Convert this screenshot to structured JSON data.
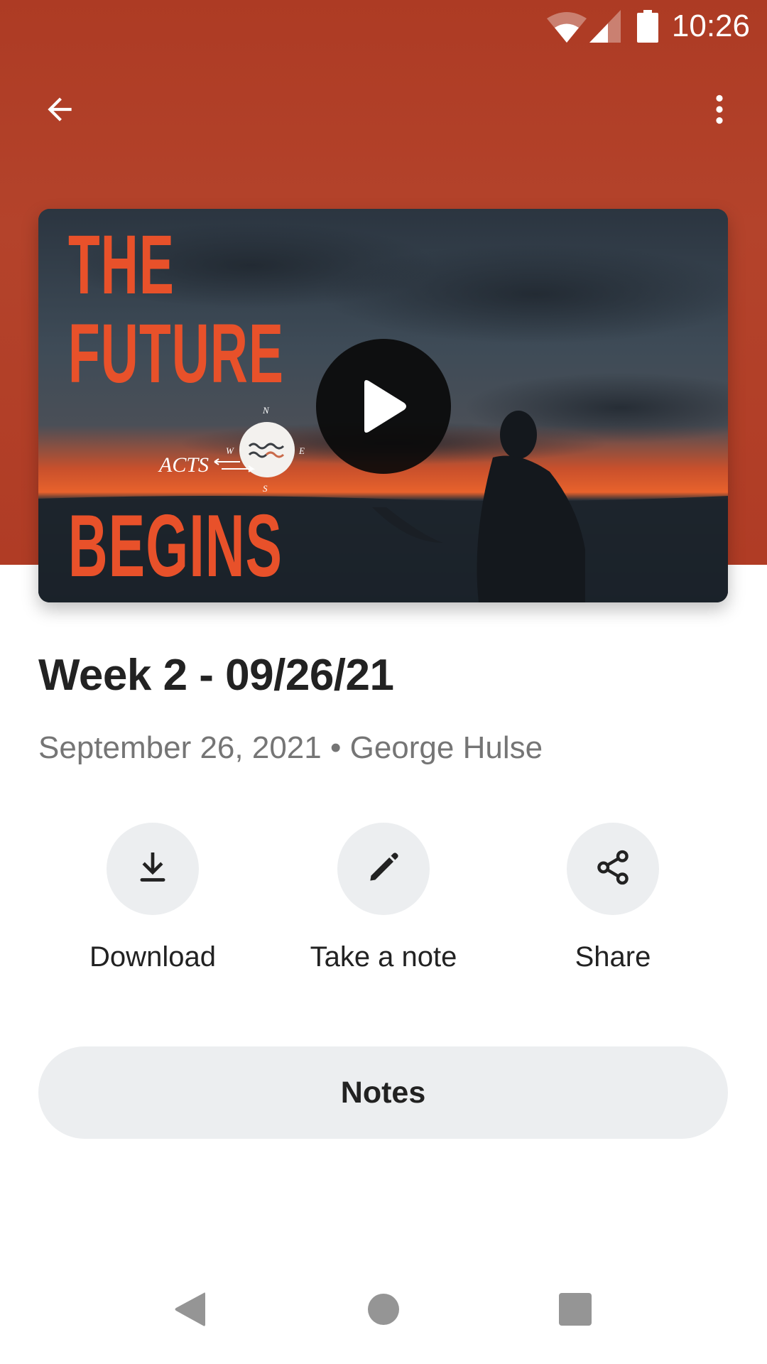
{
  "colors": {
    "header": "#b03c25",
    "thumbnail_title": "#e8512a",
    "title_text": "#222222",
    "subtitle_text": "#757575",
    "button_bg": "#eceef0",
    "nav_icon": "#959595"
  },
  "status_bar": {
    "time": "10:26",
    "icons": [
      "wifi-icon",
      "cell-signal-icon",
      "battery-icon"
    ]
  },
  "toolbar": {
    "back_icon": "arrow-back-icon",
    "menu_icon": "more-vert-icon"
  },
  "media": {
    "thumbnail": {
      "title_line1": "THE",
      "title_line2": "FUTURE",
      "title_line3": "BEGINS",
      "logo_text": "ACTS",
      "compass": {
        "n": "N",
        "s": "S",
        "e": "E",
        "w": "W"
      }
    },
    "play_icon": "play-icon"
  },
  "sermon": {
    "title": "Week 2 - 09/26/21",
    "date": "September 26, 2021",
    "separator": "•",
    "speaker": "George Hulse"
  },
  "actions": [
    {
      "label": "Download",
      "icon": "download-icon"
    },
    {
      "label": "Take a note",
      "icon": "pencil-icon"
    },
    {
      "label": "Share",
      "icon": "share-icon"
    }
  ],
  "notes_button": {
    "label": "Notes"
  },
  "nav_bar": {
    "items": [
      "nav-back-icon",
      "nav-home-icon",
      "nav-recents-icon"
    ]
  }
}
